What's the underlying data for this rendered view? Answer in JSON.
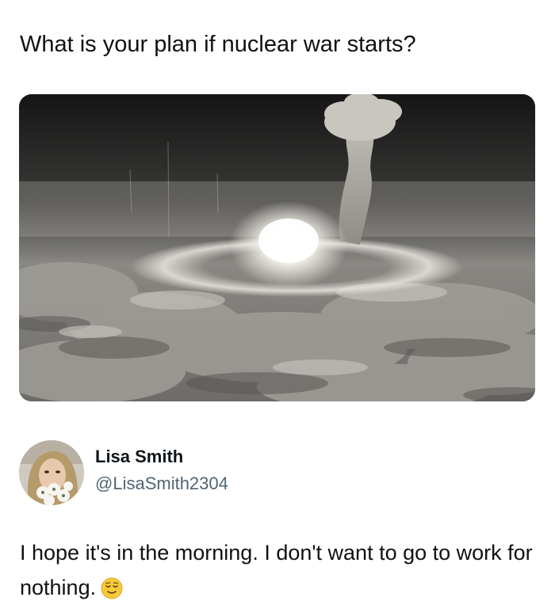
{
  "post": {
    "question": "What is your plan if nuclear war starts?",
    "image_description_icon": "mushroom-cloud-photo"
  },
  "reply": {
    "author": {
      "display_name": "Lisa Smith",
      "handle": "@LisaSmith2304",
      "avatar_icon": "profile-photo"
    },
    "text": "I hope it's in the morning. I don't want to go to work for nothing.",
    "emoji_icon": "relieved-face-emoji"
  },
  "colors": {
    "text": "#111111",
    "handle": "#536471",
    "emoji_face": "#f7c93a"
  }
}
